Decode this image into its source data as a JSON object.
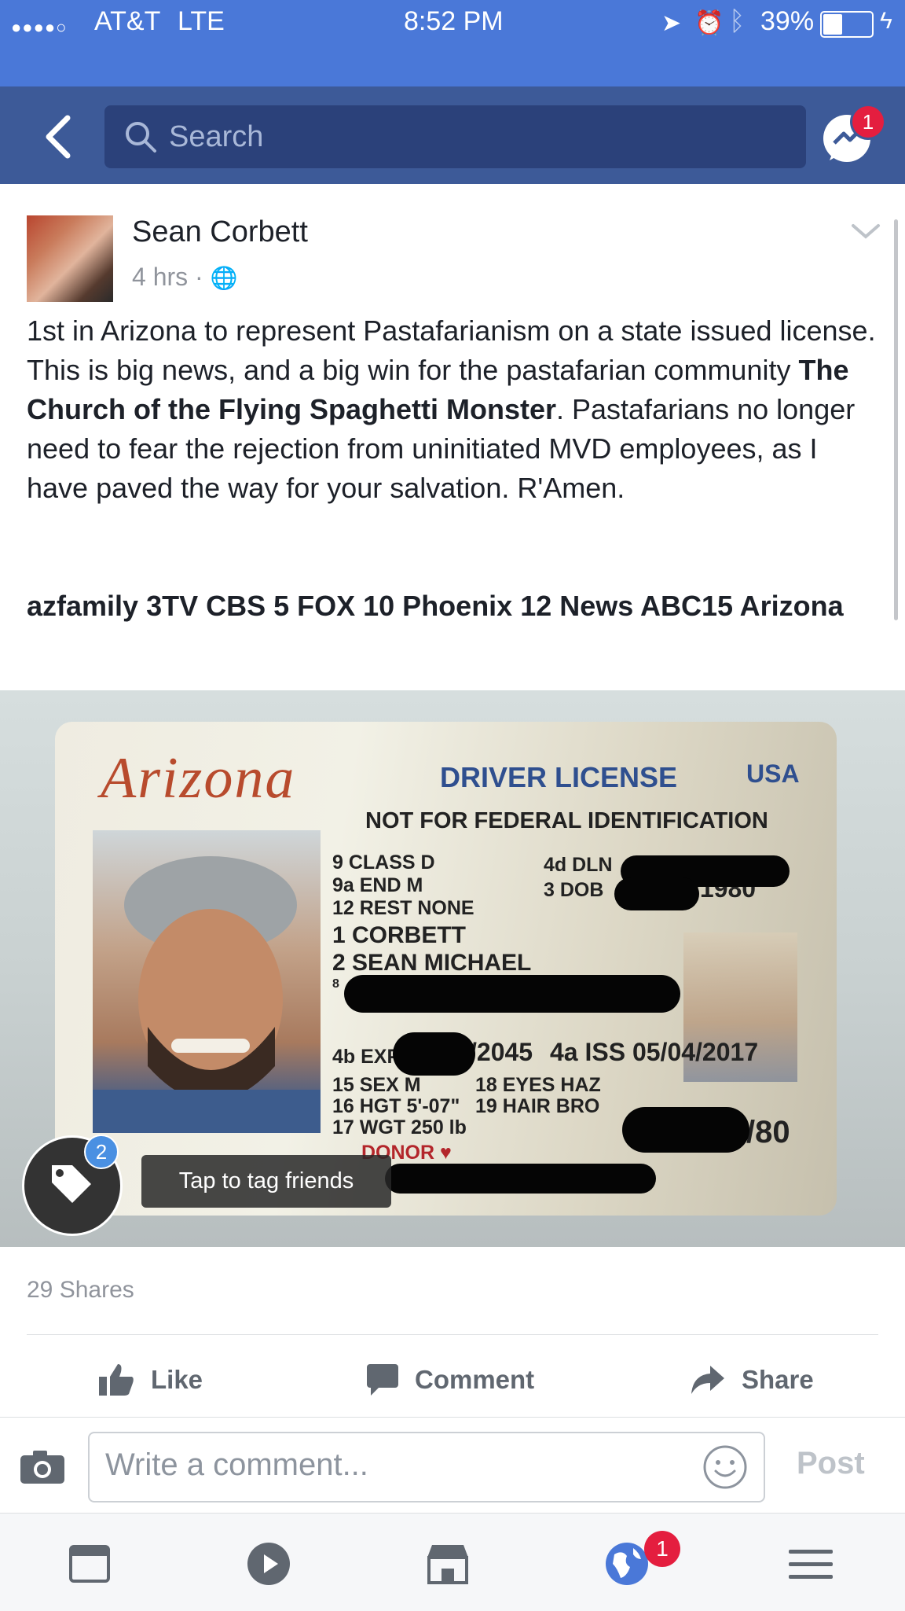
{
  "status_bar": {
    "carrier": "AT&T",
    "network": "LTE",
    "time": "8:52 PM",
    "battery": "39%"
  },
  "nav": {
    "search_placeholder": "Search",
    "messenger_badge": "1"
  },
  "post": {
    "author": "Sean Corbett",
    "time": "4 hrs",
    "text": "1st in Arizona to represent Pastafarianism on a state issued license. This is big news, and a big win for the pastafarian community ",
    "bold_mention": "The Church of the Flying Spaghetti Monster",
    "text_end": ". Pastafarians no longer need to fear the rejection from uninitiated MVD employees, as I have paved the way for your salvation. R'Amen.",
    "tags": "azfamily 3TV CBS 5 FOX 10 Phoenix 12 News ABC15 Arizona"
  },
  "license": {
    "state": "Arizona",
    "title": "DRIVER LICENSE",
    "country": "USA",
    "notice": "NOT FOR FEDERAL IDENTIFICATION",
    "class": "9 CLASS D",
    "end": "9a END  M",
    "rest": "12 REST NONE",
    "surname": "1 CORBETT",
    "given": "2 SEAN MICHAEL",
    "dln": "4d DLN",
    "dob_label": "3 DOB",
    "dob_year": "/1980",
    "exp_label": "4b EXP",
    "exp_year": "/2045",
    "iss": "4a ISS 05/04/2017",
    "sex": "15 SEX  M",
    "hgt": "16 HGT 5'-07\"",
    "wgt": "17 WGT 250 lb",
    "eyes": "18 EYES HAZ",
    "hair": "19 HAIR BRO",
    "donor": "DONOR",
    "tail": "/80",
    "eight": "8"
  },
  "photo_overlay": {
    "tag_count": "2",
    "tag_hint": "Tap to tag friends"
  },
  "engagement": {
    "shares": "29 Shares"
  },
  "actions": {
    "like": "Like",
    "comment": "Comment",
    "share": "Share"
  },
  "comment_box": {
    "placeholder": "Write a comment...",
    "post_label": "Post"
  },
  "tab_bar": {
    "notifications_badge": "1"
  },
  "colors": {
    "status_bg": "#4a78d8",
    "nav_bg": "#3d5a98",
    "badge": "#e41e3f"
  }
}
